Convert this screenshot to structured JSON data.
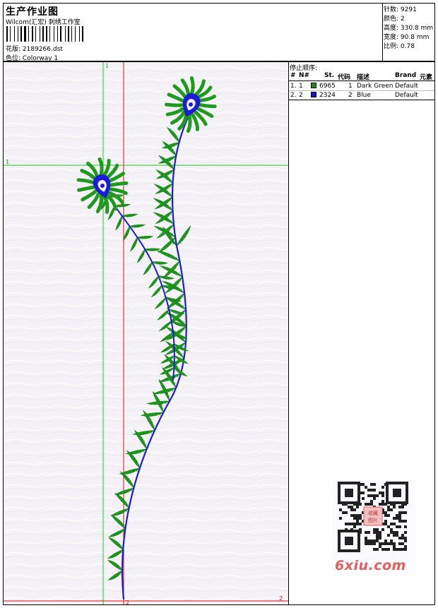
{
  "header": {
    "title": "生产作业图",
    "subtitle": "Wilcom(汇宏) 刺绣工作室",
    "design_label": "花版:",
    "design_value": "2189266.dst",
    "colorway_label": "色位:",
    "colorway_value": "Colorway 1"
  },
  "stats": [
    {
      "label": "针数:",
      "value": "9291"
    },
    {
      "label": "颜色:",
      "value": "2"
    },
    {
      "label": "高度:",
      "value": "330.8 mm"
    },
    {
      "label": "宽度:",
      "value": "90.8 mm"
    },
    {
      "label": "比例:",
      "value": "0.78"
    }
  ],
  "stop_sequence": {
    "title": "停止顺序:",
    "columns": [
      "#",
      "N#",
      "St.",
      "代码",
      "描述",
      "Brand",
      "元素"
    ],
    "rows": [
      {
        "index": "1.",
        "n": "1",
        "stitches": "6965",
        "code": "1",
        "description": "Dark Green",
        "brand": "Default",
        "color": "#1c8a1c"
      },
      {
        "index": "2.",
        "n": "2",
        "stitches": "2324",
        "code": "2",
        "description": "Blue",
        "brand": "Default",
        "color": "#1414d2"
      }
    ]
  },
  "guides": {
    "green_vertical_label": "1",
    "green_horizontal_label": "1",
    "red_vertical_label": "2",
    "red_horizontal_label": "2"
  },
  "thread_colors": {
    "green": "#1e9a1e",
    "blue": "#1b1bd8",
    "guide_green": "#22cc22",
    "guide_red": "#e01010"
  },
  "watermark": {
    "text": "6xiu.com",
    "seal_text": "收藏图片"
  }
}
